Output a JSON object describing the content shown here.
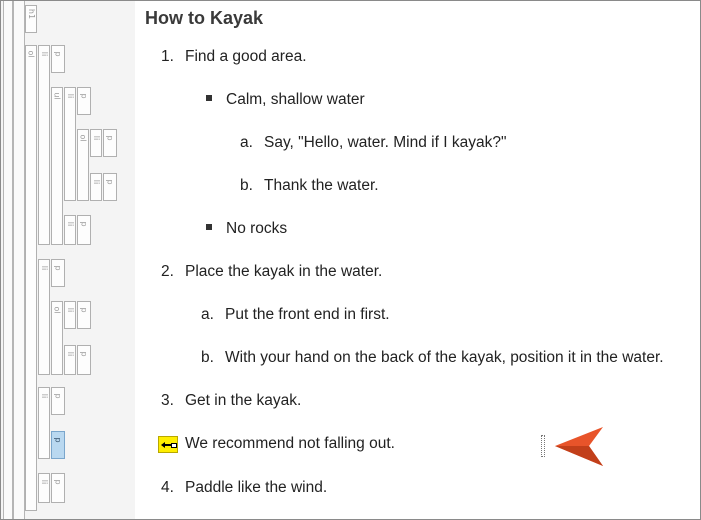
{
  "structure_bar": {
    "tags": {
      "h1": "h1",
      "ol": "ol",
      "li": "li",
      "p": "p",
      "ul": "ul"
    }
  },
  "document": {
    "heading": "How to Kayak",
    "lines": [
      {
        "marker": "1.",
        "text": "Find a good area."
      },
      {
        "marker": "square",
        "text": "Calm, shallow water"
      },
      {
        "marker": "a.",
        "text": "Say, \"Hello, water. Mind if I kayak?\""
      },
      {
        "marker": "b.",
        "text": "Thank the water."
      },
      {
        "marker": "square",
        "text": "No rocks"
      },
      {
        "marker": "2.",
        "text": "Place the kayak in the water."
      },
      {
        "marker": "a.",
        "text": "Put the front end in first."
      },
      {
        "marker": "b.",
        "text": "With your hand on the back of the kayak, position it in the water."
      },
      {
        "marker": "3.",
        "text": "Get in the kayak."
      },
      {
        "marker": "condition-icon",
        "text": "We recommend not falling out."
      },
      {
        "marker": "4.",
        "text": "Paddle like the wind."
      }
    ]
  },
  "colors": {
    "pointer_arrow": "#e8542a",
    "condition_tag": "#ffee00",
    "selected_block": "#b9d8f0"
  }
}
